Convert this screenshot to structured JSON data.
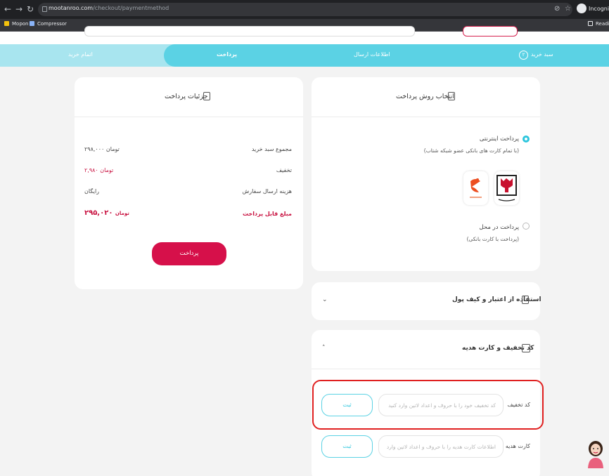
{
  "browser": {
    "url_domain": "mootanroo.com",
    "url_path": "/checkout/paymentmethod",
    "profile_label": "Incognito",
    "reading_label": "Reading",
    "bookmarks": [
      "Mopon",
      "Compressor"
    ]
  },
  "steps": {
    "cart": "سبد خرید",
    "cart_number": "۲",
    "shipping": "اطلاعات ارسال",
    "payment": "پرداخت",
    "finish": "اتمام خرید"
  },
  "summary": {
    "title": "جزئیات پرداخت",
    "rows": [
      {
        "label": "مجموع سبد خرید",
        "value": "۲۹۸,۰۰۰",
        "unit": "تومان"
      },
      {
        "label": "تخفیف",
        "value": "۲,۹۸۰",
        "unit": "تومان"
      },
      {
        "label": "هزینه ارسال سفارش",
        "value": "رایگان",
        "unit": ""
      },
      {
        "label": "مبلغ قابل پرداخت",
        "value": "۲۹۵,۰۲۰",
        "unit": "تومان"
      }
    ],
    "pay_button": "پرداخت"
  },
  "methods": {
    "title": "انتخاب روش پرداخت",
    "online_title": "پرداخت اینترنتی",
    "online_sub": "(با تمام کارت های بانکی عضو شبکه شتاب)",
    "onsite_title": "پرداخت در محل",
    "onsite_sub": "(پرداخت با کارت بانکی)",
    "bank1": "بانک پاسارگاد",
    "bank2": "آپ"
  },
  "wallet": {
    "title": "استفاده از اعتبار و کیف پول"
  },
  "discount": {
    "title": "کد تخفیف و کارت هدیه",
    "code_label": "کد تخفیف",
    "code_placeholder": "کد تخفیف خود را با حروف و اعداد لاتین وارد کنید",
    "gift_label": "کارت هدیه",
    "gift_placeholder": "اطلاعات کارت هدیه را با حروف و اعداد لاتین وارد کنید",
    "submit": "ثبت"
  },
  "colors": {
    "accent": "#5bd2e4",
    "brand_red": "#d6104a",
    "highlight": "#e02020"
  }
}
